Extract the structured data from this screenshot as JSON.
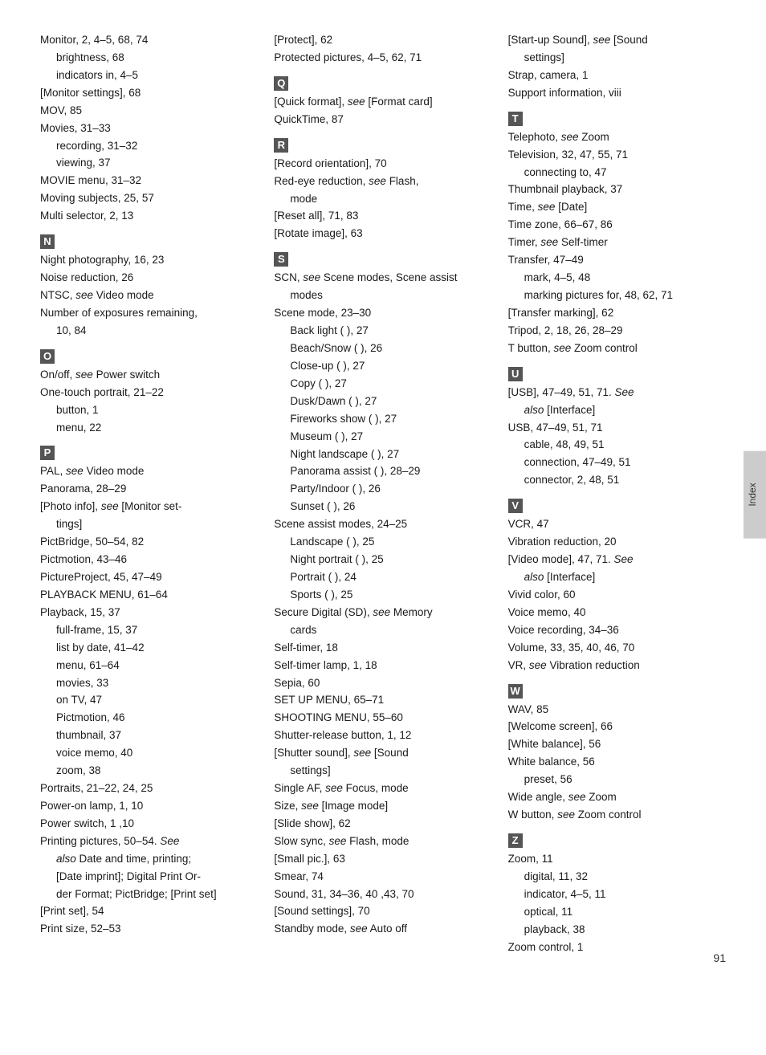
{
  "page_number": "91",
  "index_tab_label": "Index",
  "columns": [
    {
      "id": "col1",
      "entries": [
        {
          "text": "Monitor, 2, 4–5, 68, 74",
          "indent": 0
        },
        {
          "text": "brightness, 68",
          "indent": 1
        },
        {
          "text": "indicators in, 4–5",
          "indent": 1
        },
        {
          "text": "[Monitor settings], 68",
          "indent": 0
        },
        {
          "text": "MOV, 85",
          "indent": 0
        },
        {
          "text": "Movies, 31–33",
          "indent": 0
        },
        {
          "text": "recording, 31–32",
          "indent": 1
        },
        {
          "text": "viewing, 37",
          "indent": 1
        },
        {
          "text": "MOVIE menu, 31–32",
          "indent": 0
        },
        {
          "text": "Moving subjects, 25, 57",
          "indent": 0
        },
        {
          "text": "Multi selector, 2, 13",
          "indent": 0
        },
        {
          "letter": "N"
        },
        {
          "text": "Night photography, 16, 23",
          "indent": 0
        },
        {
          "text": "Noise reduction, 26",
          "indent": 0
        },
        {
          "text": "NTSC, see Video mode",
          "indent": 0,
          "italic_part": "see"
        },
        {
          "text": "Number of exposures remaining,",
          "indent": 0
        },
        {
          "text": "10, 84",
          "indent": 1
        },
        {
          "letter": "O"
        },
        {
          "text": "On/off, see Power switch",
          "indent": 0,
          "italic_part": "see"
        },
        {
          "text": "One-touch portrait, 21–22",
          "indent": 0
        },
        {
          "text": "button, 1",
          "indent": 1
        },
        {
          "text": "menu, 22",
          "indent": 1
        },
        {
          "letter": "P"
        },
        {
          "text": "PAL, see Video mode",
          "indent": 0,
          "italic_part": "see"
        },
        {
          "text": "Panorama, 28–29",
          "indent": 0
        },
        {
          "text": "[Photo info], see [Monitor set-",
          "indent": 0,
          "italic_part": "see"
        },
        {
          "text": "tings]",
          "indent": 1
        },
        {
          "text": "PictBridge, 50–54, 82",
          "indent": 0
        },
        {
          "text": "Pictmotion, 43–46",
          "indent": 0
        },
        {
          "text": "PictureProject, 45, 47–49",
          "indent": 0
        },
        {
          "text": "PLAYBACK MENU, 61–64",
          "indent": 0
        },
        {
          "text": "Playback, 15, 37",
          "indent": 0
        },
        {
          "text": "full-frame, 15, 37",
          "indent": 1
        },
        {
          "text": "list by date, 41–42",
          "indent": 1
        },
        {
          "text": "menu, 61–64",
          "indent": 1
        },
        {
          "text": "movies, 33",
          "indent": 1
        },
        {
          "text": "on TV, 47",
          "indent": 1
        },
        {
          "text": "Pictmotion, 46",
          "indent": 1
        },
        {
          "text": "thumbnail, 37",
          "indent": 1
        },
        {
          "text": "voice memo, 40",
          "indent": 1
        },
        {
          "text": "zoom, 38",
          "indent": 1
        },
        {
          "text": "Portraits, 21–22, 24, 25",
          "indent": 0
        },
        {
          "text": "Power-on lamp, 1, 10",
          "indent": 0
        },
        {
          "text": "Power switch, 1 ,10",
          "indent": 0
        },
        {
          "text": "Printing pictures, 50–54. See",
          "indent": 0,
          "italic_part": "See"
        },
        {
          "text": "also Date and time, printing;",
          "indent": 1,
          "italic_part": "also"
        },
        {
          "text": "[Date imprint]; Digital Print Or-",
          "indent": 1
        },
        {
          "text": "der Format; PictBridge; [Print set]",
          "indent": 1
        },
        {
          "text": "[Print set], 54",
          "indent": 0
        },
        {
          "text": "Print size, 52–53",
          "indent": 0
        }
      ]
    },
    {
      "id": "col2",
      "entries": [
        {
          "text": "[Protect], 62",
          "indent": 0
        },
        {
          "text": "Protected pictures, 4–5, 62, 71",
          "indent": 0
        },
        {
          "letter": "Q"
        },
        {
          "text": "[Quick format], see [Format card]",
          "indent": 0,
          "italic_part": "see"
        },
        {
          "text": "QuickTime,  87",
          "indent": 0
        },
        {
          "letter": "R"
        },
        {
          "text": "[Record orientation], 70",
          "indent": 0
        },
        {
          "text": "Red-eye reduction, see Flash,",
          "indent": 0,
          "italic_part": "see"
        },
        {
          "text": "mode",
          "indent": 1
        },
        {
          "text": "[Reset all], 71, 83",
          "indent": 0
        },
        {
          "text": "[Rotate image], 63",
          "indent": 0
        },
        {
          "letter": "S"
        },
        {
          "text": "SCN, see Scene modes, Scene assist",
          "indent": 0,
          "italic_part": "see",
          "bold_start": "SCN"
        },
        {
          "text": "modes",
          "indent": 1
        },
        {
          "text": "Scene mode, 23–30",
          "indent": 0
        },
        {
          "text": "Back light (    ), 27",
          "indent": 1
        },
        {
          "text": "Beach/Snow (    ), 26",
          "indent": 1
        },
        {
          "text": "Close-up (    ), 27",
          "indent": 1
        },
        {
          "text": "Copy (    ), 27",
          "indent": 1
        },
        {
          "text": "Dusk/Dawn (    ), 27",
          "indent": 1
        },
        {
          "text": "Fireworks show (    ), 27",
          "indent": 1
        },
        {
          "text": "Museum (    ), 27",
          "indent": 1
        },
        {
          "text": "Night landscape (    ), 27",
          "indent": 1
        },
        {
          "text": "Panorama assist (    ), 28–29",
          "indent": 1
        },
        {
          "text": "Party/Indoor (    ), 26",
          "indent": 1
        },
        {
          "text": "Sunset (    ), 26",
          "indent": 1
        },
        {
          "text": "Scene assist modes, 24–25",
          "indent": 0
        },
        {
          "text": "Landscape (    ), 25",
          "indent": 1
        },
        {
          "text": "Night portrait (    ), 25",
          "indent": 1
        },
        {
          "text": "Portrait (    ), 24",
          "indent": 1
        },
        {
          "text": "Sports (    ), 25",
          "indent": 1
        },
        {
          "text": "Secure Digital (SD), see Memory",
          "indent": 0,
          "italic_part": "see"
        },
        {
          "text": "cards",
          "indent": 1
        },
        {
          "text": "Self-timer, 18",
          "indent": 0
        },
        {
          "text": "Self-timer lamp, 1, 18",
          "indent": 0
        },
        {
          "text": "Sepia, 60",
          "indent": 0
        },
        {
          "text": "SET UP MENU, 65–71",
          "indent": 0
        },
        {
          "text": "SHOOTING MENU, 55–60",
          "indent": 0
        },
        {
          "text": "Shutter-release button, 1, 12",
          "indent": 0
        },
        {
          "text": "[Shutter sound], see [Sound",
          "indent": 0,
          "italic_part": "see"
        },
        {
          "text": "settings]",
          "indent": 1
        },
        {
          "text": "Single AF, see Focus, mode",
          "indent": 0,
          "italic_part": "see"
        },
        {
          "text": "Size, see [Image mode]",
          "indent": 0,
          "italic_part": "see"
        },
        {
          "text": "[Slide show], 62",
          "indent": 0
        },
        {
          "text": "Slow sync, see Flash, mode",
          "indent": 0,
          "italic_part": "see"
        },
        {
          "text": "[Small pic.], 63",
          "indent": 0
        },
        {
          "text": "Smear, 74",
          "indent": 0
        },
        {
          "text": "Sound, 31, 34–36, 40 ,43, 70",
          "indent": 0
        },
        {
          "text": "[Sound settings], 70",
          "indent": 0
        },
        {
          "text": "Standby mode, see Auto off",
          "indent": 0,
          "italic_part": "see"
        }
      ]
    },
    {
      "id": "col3",
      "entries": [
        {
          "text": "[Start-up Sound], see [Sound",
          "indent": 0,
          "italic_part": "see"
        },
        {
          "text": "settings]",
          "indent": 1
        },
        {
          "text": "Strap, camera, 1",
          "indent": 0
        },
        {
          "text": "Support information, viii",
          "indent": 0
        },
        {
          "letter": "T"
        },
        {
          "text": "Telephoto, see Zoom",
          "indent": 0,
          "italic_part": "see"
        },
        {
          "text": "Television, 32, 47, 55, 71",
          "indent": 0
        },
        {
          "text": "connecting to, 47",
          "indent": 1
        },
        {
          "text": "Thumbnail playback, 37",
          "indent": 0
        },
        {
          "text": "Time, see [Date]",
          "indent": 0,
          "italic_part": "see"
        },
        {
          "text": "Time zone, 66–67, 86",
          "indent": 0
        },
        {
          "text": "Timer, see Self-timer",
          "indent": 0,
          "italic_part": "see"
        },
        {
          "text": "Transfer, 47–49",
          "indent": 0
        },
        {
          "text": "mark, 4–5, 48",
          "indent": 1
        },
        {
          "text": "marking pictures for, 48, 62, 71",
          "indent": 1
        },
        {
          "text": "[Transfer marking], 62",
          "indent": 0
        },
        {
          "text": "Tripod, 2, 18, 26, 28–29",
          "indent": 0
        },
        {
          "text": "T button, see Zoom control",
          "indent": 0,
          "italic_part": "see",
          "bold_start": "T"
        },
        {
          "letter": "U"
        },
        {
          "text": "[USB], 47–49, 51, 71.  See",
          "indent": 0,
          "italic_part": "See"
        },
        {
          "text": "also [Interface]",
          "indent": 1,
          "italic_part": "also"
        },
        {
          "text": "USB, 47–49, 51, 71",
          "indent": 0
        },
        {
          "text": "cable, 48, 49, 51",
          "indent": 1
        },
        {
          "text": "connection, 47–49, 51",
          "indent": 1
        },
        {
          "text": "connector, 2, 48, 51",
          "indent": 1
        },
        {
          "letter": "V"
        },
        {
          "text": "VCR, 47",
          "indent": 0
        },
        {
          "text": "Vibration reduction, 20",
          "indent": 0
        },
        {
          "text": "[Video mode], 47, 71.  See",
          "indent": 0,
          "italic_part": "See"
        },
        {
          "text": "also [Interface]",
          "indent": 1,
          "italic_part": "also"
        },
        {
          "text": "Vivid color, 60",
          "indent": 0
        },
        {
          "text": "Voice memo, 40",
          "indent": 0
        },
        {
          "text": "Voice recording, 34–36",
          "indent": 0
        },
        {
          "text": "Volume, 33, 35, 40, 46, 70",
          "indent": 0
        },
        {
          "text": "VR, see Vibration reduction",
          "indent": 0,
          "italic_part": "see"
        },
        {
          "letter": "W"
        },
        {
          "text": "WAV, 85",
          "indent": 0
        },
        {
          "text": "[Welcome screen], 66",
          "indent": 0
        },
        {
          "text": "[White balance], 56",
          "indent": 0
        },
        {
          "text": "White balance, 56",
          "indent": 0
        },
        {
          "text": "preset, 56",
          "indent": 1
        },
        {
          "text": "Wide angle, see Zoom",
          "indent": 0,
          "italic_part": "see"
        },
        {
          "text": "W button, see Zoom control",
          "indent": 0,
          "italic_part": "see",
          "bold_start": "W"
        },
        {
          "letter": "Z"
        },
        {
          "text": "Zoom, 11",
          "indent": 0
        },
        {
          "text": "digital, 11, 32",
          "indent": 1
        },
        {
          "text": "indicator, 4–5, 11",
          "indent": 1
        },
        {
          "text": "optical, 11",
          "indent": 1
        },
        {
          "text": "playback, 38",
          "indent": 1
        },
        {
          "text": "Zoom control, 1",
          "indent": 0
        }
      ]
    }
  ]
}
